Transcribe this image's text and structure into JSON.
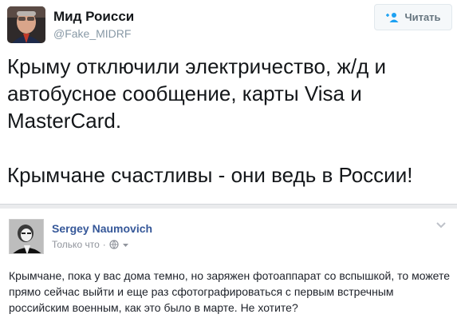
{
  "tweet": {
    "author_name": "Мид Роисси",
    "handle": "@Fake_MIDRF",
    "follow_label": "Читать",
    "text_line1": "Крыму отключили электричество, ж/д и автобусное сообщение, карты Visa и MasterCard.",
    "text_line2": "Крымчане счастливы - они ведь в России!",
    "avatar_icon": "profile-photo",
    "follow_icon": "add-user-icon",
    "accent_color": "#1da1f2"
  },
  "facebook_post": {
    "author_name": "Sergey Naumovich",
    "timestamp": "Только что",
    "separator": "·",
    "privacy_icon": "globe-icon",
    "menu_icon": "chevron-down-icon",
    "text": "Крымчане, пока у вас дома темно, но заряжен фотоаппарат со вспышкой, то можете прямо сейчас выйти и еще раз сфотографироваться с первым встречным российским военным, как это было в марте. Не хотите?",
    "name_color": "#365899"
  }
}
